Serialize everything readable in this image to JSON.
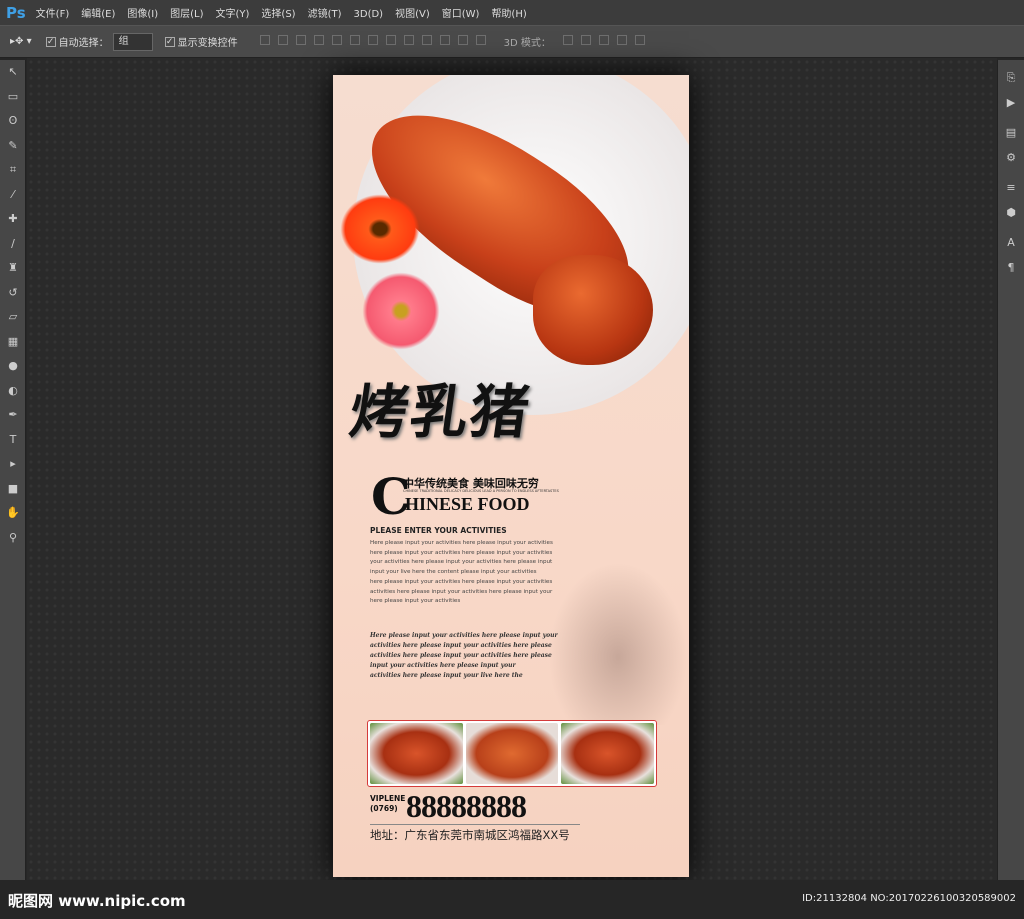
{
  "app": {
    "logo": "Ps"
  },
  "menu": [
    "文件(F)",
    "编辑(E)",
    "图像(I)",
    "图层(L)",
    "文字(Y)",
    "选择(S)",
    "滤镜(T)",
    "3D(D)",
    "视图(V)",
    "窗口(W)",
    "帮助(H)"
  ],
  "options": {
    "auto_select_label": "自动选择：",
    "auto_select_value": "组",
    "show_transform_label": "显示变换控件",
    "mode_3d_label": "3D 模式："
  },
  "tools": [
    "move",
    "marquee",
    "lasso",
    "quick-select",
    "crop",
    "eyedropper",
    "healing",
    "brush",
    "stamp",
    "history-brush",
    "eraser",
    "gradient",
    "blur",
    "dodge",
    "pen",
    "type",
    "path-select",
    "shape",
    "hand",
    "zoom"
  ],
  "tool_glyphs": [
    "↖",
    "▭",
    "ʘ",
    "✎",
    "⌗",
    "⁄",
    "✚",
    "∕",
    "♜",
    "↺",
    "▱",
    "▦",
    "●",
    "◐",
    "✒",
    "T",
    "▸",
    "■",
    "✋",
    "⚲"
  ],
  "right_panel_glyphs": [
    "⎘",
    "▶",
    "▤",
    "⚙",
    "≡",
    "⬢",
    "A",
    "¶"
  ],
  "poster": {
    "title": "烤乳猪",
    "slogan": "中华传统美食  美味回味无穷",
    "tiny_en": "CHINESE TRADITIONAL DELICACY DELICIOUS LEAD A PERSON TO ENDLESS AFTERTASTES",
    "big_c": "C",
    "en_title": "HINESE FOOD",
    "activities_title": "PLEASE ENTER YOUR ACTIVITIES",
    "activities_lines": [
      "Here please input your activities here please input your activities",
      "here please input your activities here please input your activities",
      "your activities here please input your activities here please input",
      "input your live here the content please input your activities",
      "here please input your activities here please input your activities",
      " activities here please input your activities here please input your",
      "here please input your activities"
    ],
    "script_lines": [
      "Here please input your activities here please input your",
      "activities here please input your activities here please",
      "activities here please input your activities here please",
      "input your activities here please input your",
      "activities here please input your live here the"
    ],
    "vip_label": "VIPLENE",
    "area_code": "(0769)",
    "phone": "88888888",
    "address": "地址：广东省东莞市南城区鸿福路XX号"
  },
  "footer": {
    "watermark": "昵图网 www.nipic.com",
    "id": "ID:21132804 NO:20170226100320589002"
  }
}
